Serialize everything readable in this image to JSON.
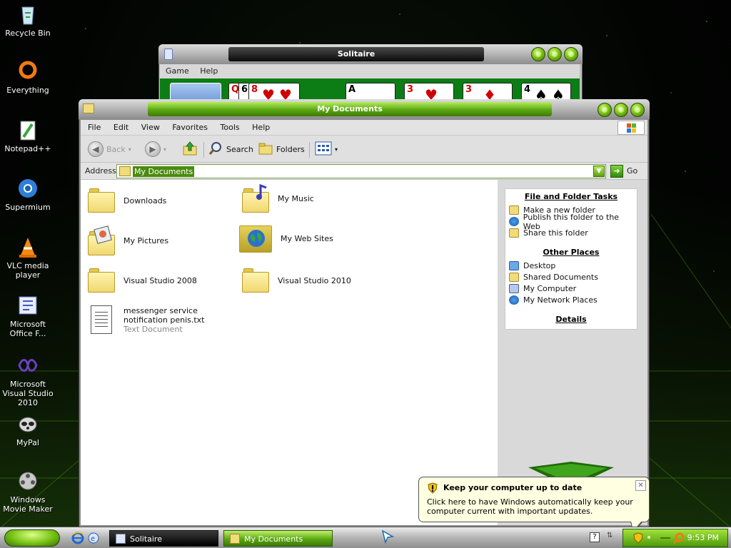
{
  "desktop": {
    "icons": [
      {
        "label": "Recycle Bin"
      },
      {
        "label": "Everything"
      },
      {
        "label": "Notepad++"
      },
      {
        "label": "Supermium"
      },
      {
        "label": "VLC media player"
      },
      {
        "label": "Microsoft Office F..."
      },
      {
        "label": "Microsoft Visual Studio 2010"
      },
      {
        "label": "MyPal"
      },
      {
        "label": "Windows Movie Maker"
      }
    ]
  },
  "solitaire": {
    "title": "Solitaire",
    "menu": [
      "Game",
      "Help"
    ],
    "cards": [
      {
        "rank": "Q",
        "suit": "♥",
        "color": "red"
      },
      {
        "rank": "6",
        "suit": "♠",
        "color": "blk"
      },
      {
        "rank": "8",
        "suit": "♥",
        "color": "red"
      },
      {
        "rank": "A",
        "suit": "♣",
        "color": "blk"
      },
      {
        "rank": "3",
        "suit": "♥",
        "color": "red"
      },
      {
        "rank": "3",
        "suit": "♦",
        "color": "red"
      },
      {
        "rank": "4",
        "suit": "♠",
        "color": "blk"
      }
    ]
  },
  "explorer": {
    "title": "My Documents",
    "menu": [
      "File",
      "Edit",
      "View",
      "Favorites",
      "Tools",
      "Help"
    ],
    "toolbar": {
      "back": "Back",
      "search": "Search",
      "folders": "Folders"
    },
    "address": {
      "label": "Address",
      "value": "My Documents",
      "go": "Go"
    },
    "items": [
      {
        "name": "Downloads",
        "type": "folder"
      },
      {
        "name": "My Music",
        "type": "folder"
      },
      {
        "name": "My Pictures",
        "type": "folder"
      },
      {
        "name": "My Web Sites",
        "type": "folder"
      },
      {
        "name": "Visual Studio 2008",
        "type": "folder"
      },
      {
        "name": "Visual Studio 2010",
        "type": "folder"
      },
      {
        "name": "messenger service notification penis.txt",
        "type": "Text Document"
      }
    ],
    "taskpane": {
      "file_tasks": {
        "heading": "File and Folder Tasks",
        "links": [
          "Make a new folder",
          "Publish this folder to the Web",
          "Share this folder"
        ]
      },
      "other_places": {
        "heading": "Other Places",
        "links": [
          "Desktop",
          "Shared Documents",
          "My Computer",
          "My Network Places"
        ]
      },
      "details": {
        "heading": "Details"
      }
    }
  },
  "balloon": {
    "title": "Keep your computer up to date",
    "text": "Click here to have Windows automatically keep your computer current with important updates."
  },
  "taskbar": {
    "tasks": [
      {
        "label": "Solitaire",
        "active": false
      },
      {
        "label": "My Documents",
        "active": true
      }
    ],
    "clock": "9:53 PM"
  },
  "colors": {
    "accent": "#7ec41a",
    "felt": "#0b7d14",
    "balloon": "#ffffe1"
  }
}
